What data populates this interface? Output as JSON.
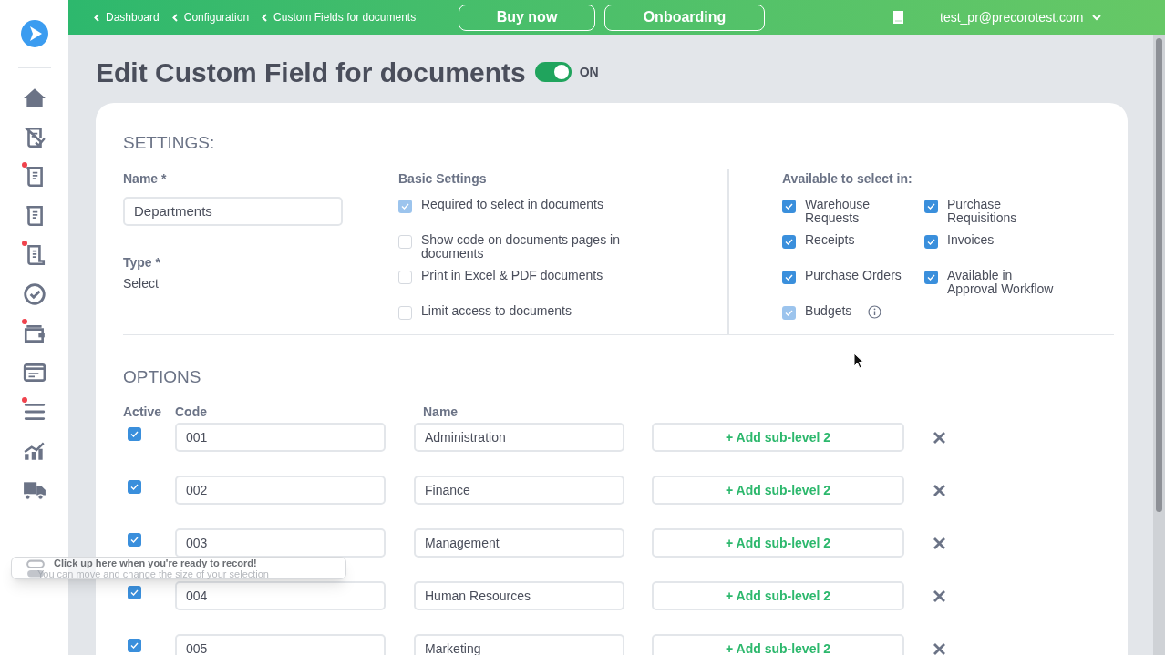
{
  "breadcrumbs": [
    "Dashboard",
    "Configuration",
    "Custom Fields for documents"
  ],
  "header_buttons": [
    "Buy now",
    "Onboarding"
  ],
  "user": {
    "email": "test_pr@precorotest.com"
  },
  "sidebar": {
    "items": [
      {
        "kind": "home",
        "badge": false
      },
      {
        "kind": "doc-check",
        "badge": false
      },
      {
        "kind": "doc",
        "badge": true
      },
      {
        "kind": "doc",
        "badge": false
      },
      {
        "kind": "scroll",
        "badge": true
      },
      {
        "kind": "check-circle",
        "badge": false
      },
      {
        "kind": "wallet",
        "badge": true
      },
      {
        "kind": "card",
        "badge": false
      },
      {
        "kind": "list",
        "badge": true
      },
      {
        "kind": "chart",
        "badge": false
      },
      {
        "kind": "truck",
        "badge": false
      }
    ]
  },
  "page": {
    "title": "Edit Custom Field for documents",
    "toggle": {
      "on": true,
      "label": "ON"
    }
  },
  "settings": {
    "heading": "SETTINGS:",
    "name": {
      "label": "Name *",
      "value": "Departments"
    },
    "type": {
      "label": "Type *",
      "value": "Select"
    },
    "basic": {
      "heading": "Basic Settings",
      "options": [
        {
          "label": "Required to select in documents",
          "checked": true,
          "disabled": true
        },
        {
          "label": "Show code on documents pages in documents",
          "checked": false,
          "disabled": false
        },
        {
          "label": "Print in Excel & PDF documents",
          "checked": false,
          "disabled": false
        },
        {
          "label": "Limit access to documents",
          "checked": false,
          "disabled": false
        }
      ]
    },
    "available": {
      "heading": "Available to select in:",
      "options": [
        {
          "label": "Warehouse Requests",
          "checked": true,
          "disabled": false,
          "info": false
        },
        {
          "label": "Purchase Requisitions",
          "checked": true,
          "disabled": false,
          "info": false
        },
        {
          "label": "Receipts",
          "checked": true,
          "disabled": false,
          "info": false
        },
        {
          "label": "Invoices",
          "checked": true,
          "disabled": false,
          "info": false
        },
        {
          "label": "Purchase Orders",
          "checked": true,
          "disabled": false,
          "info": false
        },
        {
          "label": "Available in Approval Workflow",
          "checked": true,
          "disabled": false,
          "info": false
        },
        {
          "label": "Budgets",
          "checked": true,
          "disabled": true,
          "info": true
        }
      ]
    }
  },
  "options": {
    "heading": "OPTIONS",
    "columns": [
      "Active",
      "Code",
      "Name"
    ],
    "rows": [
      {
        "active": true,
        "code": "001",
        "name": "Administration",
        "add_label": "+ Add sub-level 2"
      },
      {
        "active": true,
        "code": "002",
        "name": "Finance",
        "add_label": "+ Add sub-level 2"
      },
      {
        "active": true,
        "code": "003",
        "name": "Management",
        "add_label": "+ Add sub-level 2"
      },
      {
        "active": true,
        "code": "004",
        "name": "Human Resources",
        "add_label": "+ Add sub-level 2"
      },
      {
        "active": true,
        "code": "005",
        "name": "Marketing",
        "add_label": "+ Add sub-level 2"
      }
    ]
  },
  "toast": {
    "title": "Click up here when you're ready to record!",
    "subtitle": "You can move and change the size of your selection"
  }
}
